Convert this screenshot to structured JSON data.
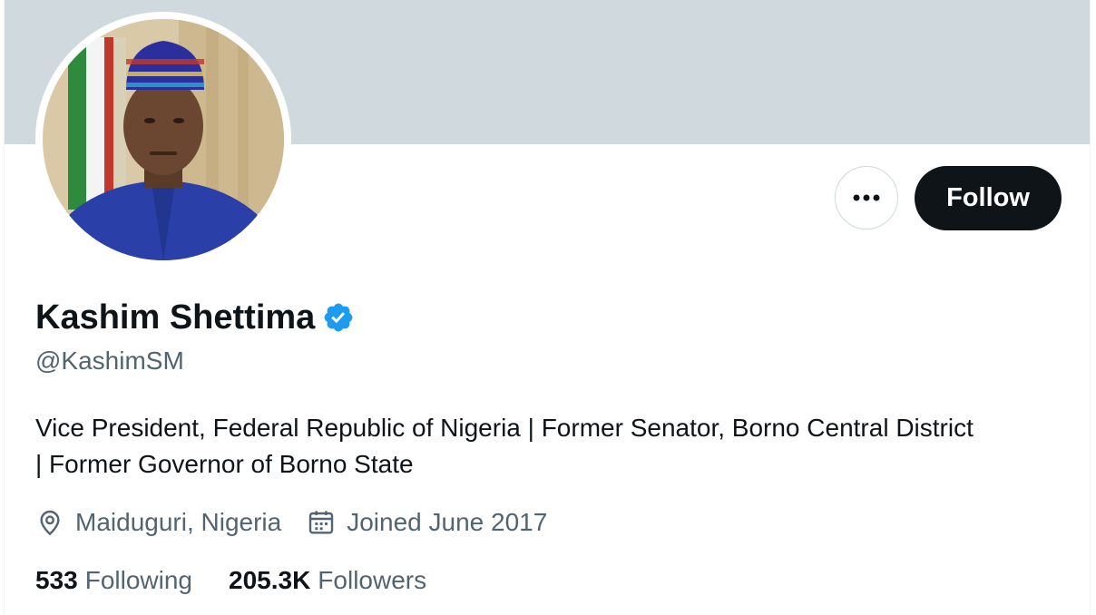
{
  "profile": {
    "display_name": "Kashim Shettima",
    "handle": "@KashimSM",
    "bio_line1": "Vice President, Federal Republic of Nigeria | Former Senator, Borno Central District",
    "bio_line2": "| Former Governor of Borno State",
    "location": "Maiduguri, Nigeria",
    "joined": "Joined June 2017",
    "verified": true
  },
  "actions": {
    "more_icon": "more-horizontal-icon",
    "follow_label": "Follow"
  },
  "stats": {
    "following_count": "533",
    "following_label": "Following",
    "followers_count": "205.3K",
    "followers_label": "Followers"
  },
  "colors": {
    "banner": "#cfd9de",
    "primary_text": "#0f1419",
    "secondary_text": "#536471",
    "verified_badge": "#1d9bf0",
    "follow_button_bg": "#0f1419"
  },
  "icons": {
    "verified": "verified-badge-icon",
    "location": "location-pin-icon",
    "calendar": "calendar-icon"
  }
}
